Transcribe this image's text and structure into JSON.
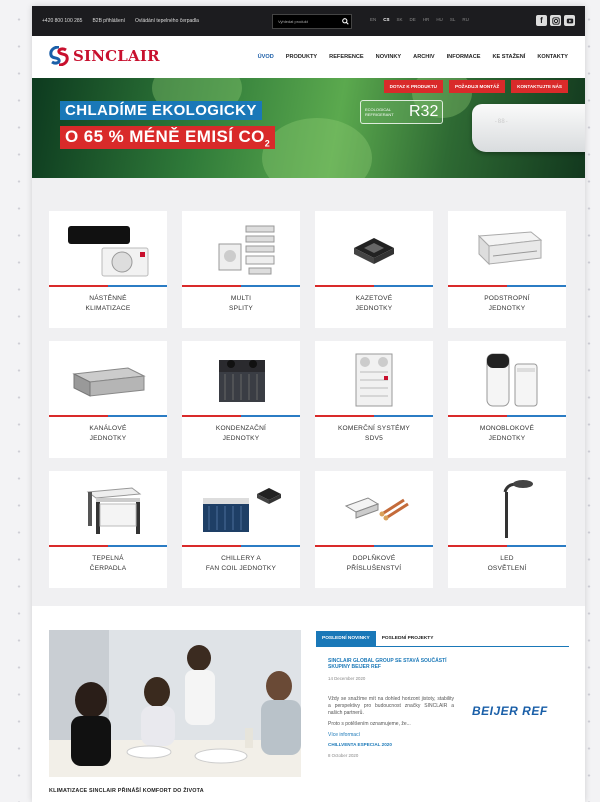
{
  "topbar": {
    "phone": "+420 800 100 285",
    "b2b": "B2B přihlášení",
    "heatpump_control": "Ovládání tepelného čerpadla",
    "search_placeholder": "Vyhledat produkt",
    "languages": [
      "EN",
      "CS",
      "SK",
      "DE",
      "HR",
      "HU",
      "SL",
      "RU"
    ]
  },
  "brand": {
    "name": "SINCLAIR"
  },
  "nav": {
    "items": [
      "ÚVOD",
      "PRODUKTY",
      "REFERENCE",
      "NOVINKY",
      "ARCHIV",
      "INFORMACE",
      "KE STAŽENÍ",
      "KONTAKTY"
    ],
    "active": "ÚVOD"
  },
  "hero": {
    "buttons": [
      "DOTAZ K PRODUKTU",
      "POŽADUJI MONTÁŽ",
      "KONTAKTUJTE NÁS"
    ],
    "headline1": "CHLADÍME EKOLOGICKY",
    "headline2": "O 65 % MÉNĚ EMISÍ CO",
    "headline2_sub": "2",
    "badge_small": "ECOLOGICAL REFRIGERANT",
    "badge_big": "R32"
  },
  "categories": [
    {
      "line1": "NÁSTĚNNÉ",
      "line2": "KLIMATIZACE"
    },
    {
      "line1": "MULTI",
      "line2": "SPLITY"
    },
    {
      "line1": "KAZETOVÉ",
      "line2": "JEDNOTKY"
    },
    {
      "line1": "PODSTROPNÍ",
      "line2": "JEDNOTKY"
    },
    {
      "line1": "KANÁLOVÉ",
      "line2": "JEDNOTKY"
    },
    {
      "line1": "KONDENZAČNÍ",
      "line2": "JEDNOTKY"
    },
    {
      "line1": "KOMERČNÍ SYSTÉMY",
      "line2": "SDV5"
    },
    {
      "line1": "MONOBLOKOVÉ",
      "line2": "JEDNOTKY"
    },
    {
      "line1": "TEPELNÁ",
      "line2": "ČERPADLA"
    },
    {
      "line1": "CHILLERY A",
      "line2": "FAN COIL JEDNOTKY"
    },
    {
      "line1": "DOPLŇKOVÉ",
      "line2": "PŘÍSLUŠENSTVÍ"
    },
    {
      "line1": "LED",
      "line2": "OSVĚTLENÍ"
    }
  ],
  "feature": {
    "caption": "KLIMATIZACE SINCLAIR PŘINÁŠÍ KOMFORT DO ŽIVOTA"
  },
  "news_tabs": {
    "latest": "POSLEDNÍ NOVINKY",
    "projects": "POSLEDNÍ PROJEKTY"
  },
  "news": {
    "title": "SINCLAIR GLOBAL GROUP SE STAVÁ SOUČÁSTÍ SKUPINY BEIJER REF",
    "date": "14 December 2020",
    "body": "Vždy se snažíme mít na dohled horizont jistoty, stability a perspektivy pro budoucnost značky SINCLAIR a našich partnerů.",
    "body2": "Proto s potěšením oznamujeme, že...",
    "more": "Více informací",
    "title2": "CHILLVENTA ESPECIAL 2020",
    "date2": "8 October 2020",
    "partner_logo": "BEIJER REF"
  },
  "colors": {
    "accent_blue": "#1a78b8",
    "accent_red": "#d92a2a",
    "topbar": "#1c1c1f"
  }
}
